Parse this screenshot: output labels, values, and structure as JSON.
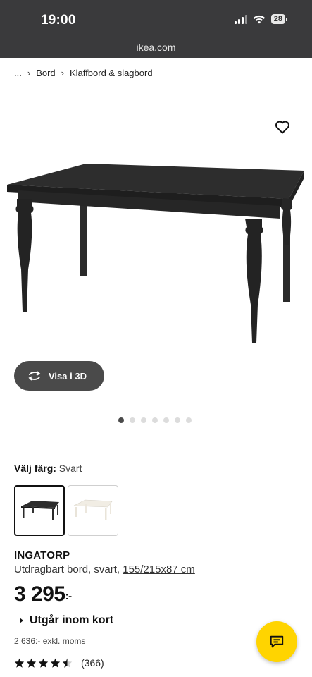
{
  "status_bar": {
    "time": "19:00",
    "battery": "28",
    "url": "ikea.com"
  },
  "breadcrumb": {
    "ellipsis": "...",
    "items": [
      "Bord",
      "Klaffbord & slagbord"
    ]
  },
  "icons": {
    "favorite": "heart-icon",
    "rotate": "rotate-3d-icon",
    "chat": "chat-icon",
    "star": "star-icon"
  },
  "view3d": {
    "label": "Visa i 3D"
  },
  "carousel": {
    "total": 7,
    "active": 1
  },
  "color": {
    "label": "Välj färg:",
    "value": "Svart",
    "options": [
      "black",
      "white"
    ]
  },
  "product": {
    "name": "INGATORP",
    "description": "Utdragbart bord, svart, ",
    "dimensions": "155/215x87 cm",
    "price": "3 295",
    "price_suffix": ":-",
    "stock": "Utgår inom kort",
    "ex_vat": "2 636:- exkl. moms"
  },
  "rating": {
    "score": 4.5,
    "max": 5,
    "count": "(366)"
  },
  "colors": {
    "topbar": "#3a3a3c",
    "chat": "#ffd400",
    "button3d": "#4a4a4a"
  }
}
